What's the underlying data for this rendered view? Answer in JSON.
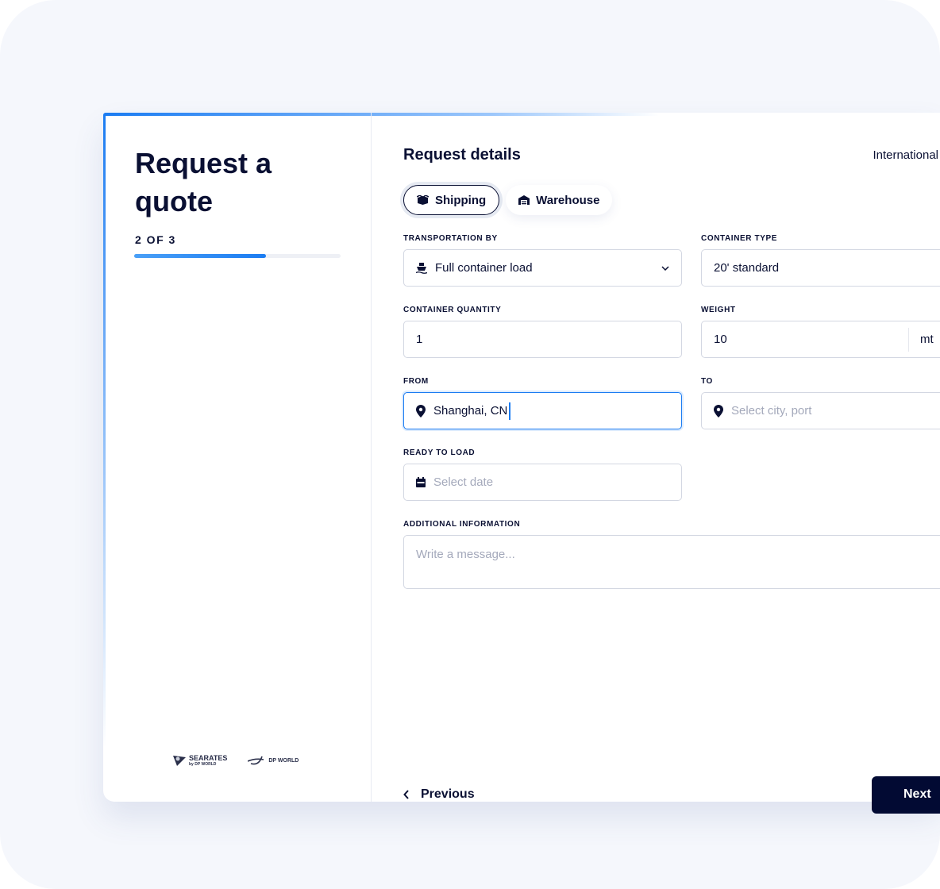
{
  "sidebar": {
    "title": "Request a quote",
    "step": "2 OF 3",
    "progress_percent": 64,
    "logos": {
      "searates": "SEARATES",
      "searates_sub": "by DP WORLD",
      "dpworld": "DP WORLD"
    }
  },
  "main": {
    "title": "Request details",
    "top_right": "International",
    "tabs": [
      {
        "label": "Shipping",
        "icon": "box-icon",
        "active": true
      },
      {
        "label": "Warehouse",
        "icon": "warehouse-icon",
        "active": false
      }
    ],
    "fields": {
      "transportation": {
        "label": "TRANSPORTATION BY",
        "value": "Full container load",
        "icon": "ship-icon"
      },
      "container_type": {
        "label": "CONTAINER TYPE",
        "value": "20' standard"
      },
      "quantity": {
        "label": "CONTAINER QUANTITY",
        "value": "1"
      },
      "weight": {
        "label": "WEIGHT",
        "value": "10",
        "unit": "mt"
      },
      "from": {
        "label": "FROM",
        "value": "Shanghai, CN"
      },
      "to": {
        "label": "TO",
        "placeholder": "Select city, port"
      },
      "ready": {
        "label": "READY TO LOAD",
        "placeholder": "Select date"
      },
      "additional": {
        "label": "ADDITIONAL INFORMATION",
        "placeholder": "Write a message..."
      }
    },
    "previous_label": "Previous",
    "next_label": "Next"
  },
  "colors": {
    "accent": "#1b7cf2",
    "navy": "#0a1033"
  }
}
